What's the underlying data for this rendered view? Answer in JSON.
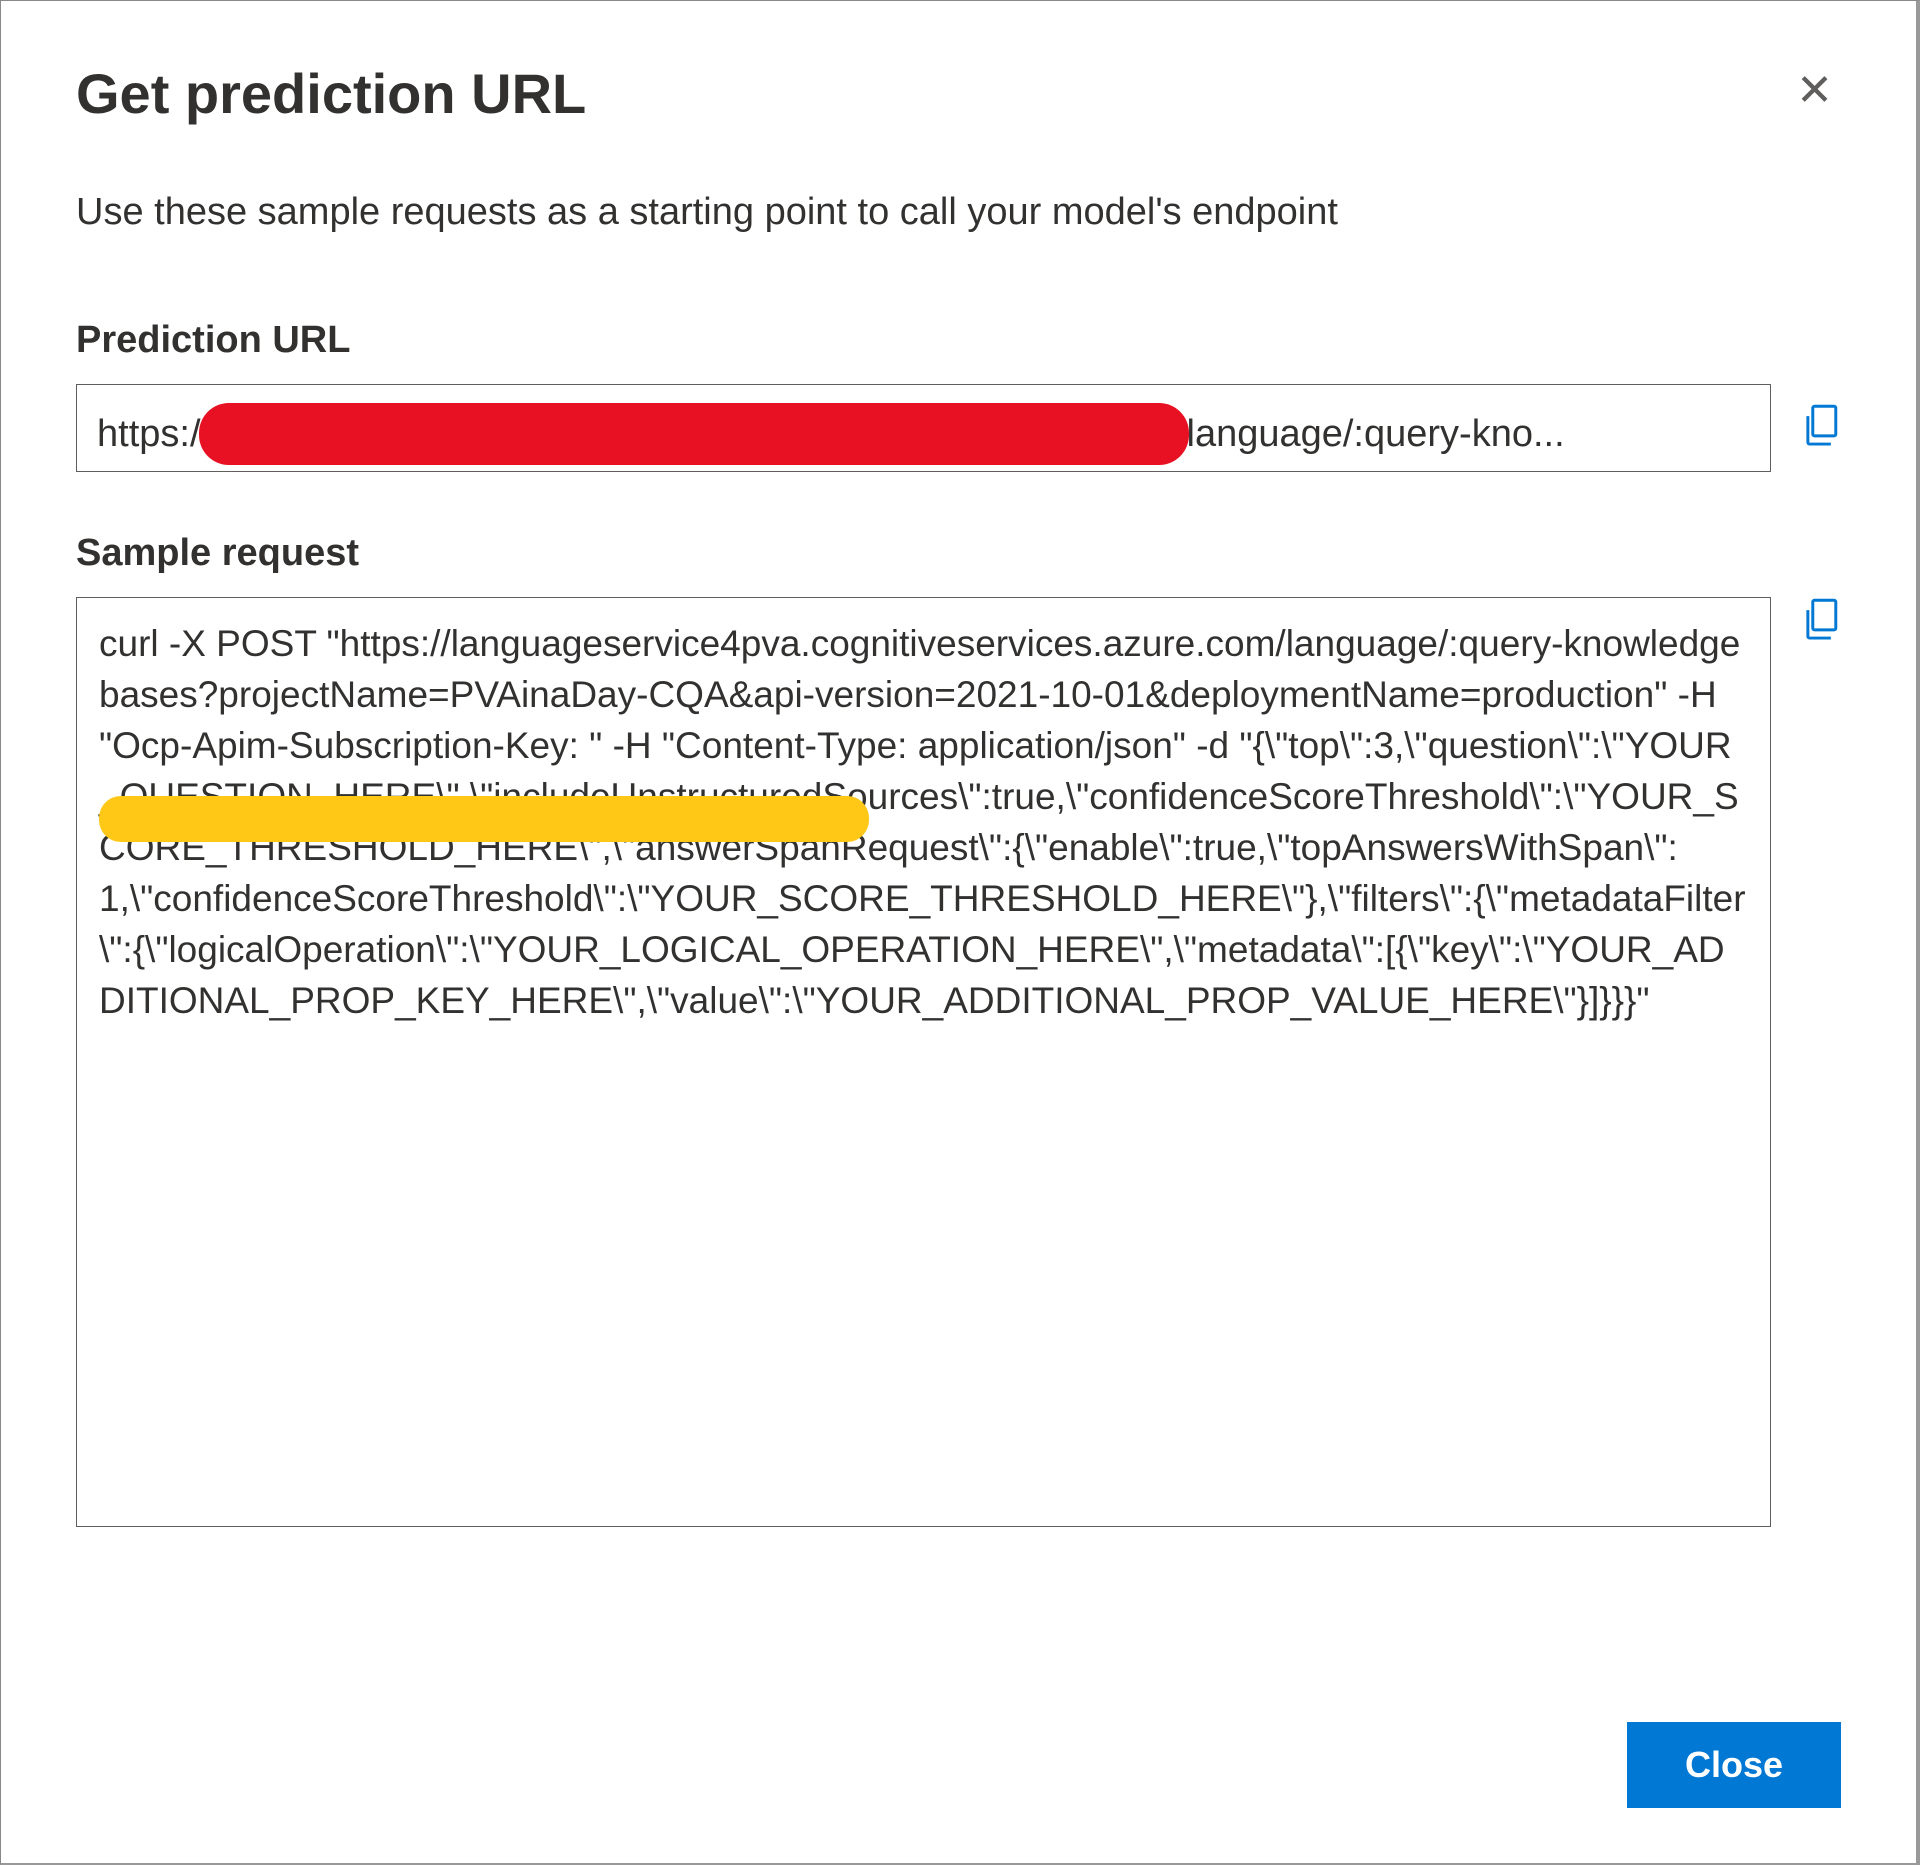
{
  "dialog": {
    "title": "Get prediction URL",
    "description": "Use these sample requests as a starting point to call your model's endpoint",
    "close_label": "Close"
  },
  "prediction_url": {
    "label": "Prediction URL",
    "value_prefix": "https:/",
    "value_suffix": "language/:query-kno..."
  },
  "sample_request": {
    "label": "Sample request",
    "value": "curl -X POST \"https://languageservice4pva.cognitiveservices.azure.com/language/:query-knowledgebases?projectName=PVAinaDay-CQA&api-version=2021-10-01&deploymentName=production\" -H \"Ocp-Apim-Subscription-Key:                                                             \" -H \"Content-Type: application/json\" -d \"{\\\"top\\\":3,\\\"question\\\":\\\"YOUR_QUESTION_HERE\\\",\\\"includeUnstructuredSources\\\":true,\\\"confidenceScoreThreshold\\\":\\\"YOUR_SCORE_THRESHOLD_HERE\\\",\\\"answerSpanRequest\\\":{\\\"enable\\\":true,\\\"topAnswersWithSpan\\\":1,\\\"confidenceScoreThreshold\\\":\\\"YOUR_SCORE_THRESHOLD_HERE\\\"},\\\"filters\\\":{\\\"metadataFilter\\\":{\\\"logicalOperation\\\":\\\"YOUR_LOGICAL_OPERATION_HERE\\\",\\\"metadata\\\":[{\\\"key\\\":\\\"YOUR_ADDITIONAL_PROP_KEY_HERE\\\",\\\"value\\\":\\\"YOUR_ADDITIONAL_PROP_VALUE_HERE\\\"}]}}}\""
  },
  "icons": {
    "close_x": "✕"
  }
}
